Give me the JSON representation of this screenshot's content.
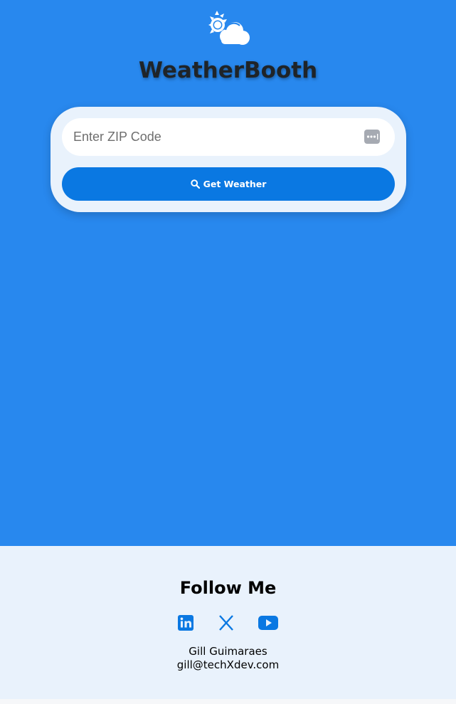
{
  "app": {
    "title": "WeatherBooth",
    "logo_icon": "sun-behind-cloud-icon"
  },
  "search": {
    "placeholder": "Enter ZIP Code",
    "value": "",
    "autofill_icon": "password-autofill-icon",
    "button_icon": "search-icon",
    "button_label": "Get Weather"
  },
  "footer": {
    "title": "Follow Me",
    "social": [
      {
        "name": "LinkedIn",
        "icon": "linkedin-icon"
      },
      {
        "name": "X",
        "icon": "x-icon"
      },
      {
        "name": "YouTube",
        "icon": "youtube-icon"
      }
    ],
    "contact_name": "Gill Guimaraes",
    "contact_email": "gill@techXdev.com"
  },
  "colors": {
    "hero_background": "#2888ee",
    "button": "#0a78e2",
    "card": "#e9f2fc",
    "social_icon": "#0a78e2"
  }
}
